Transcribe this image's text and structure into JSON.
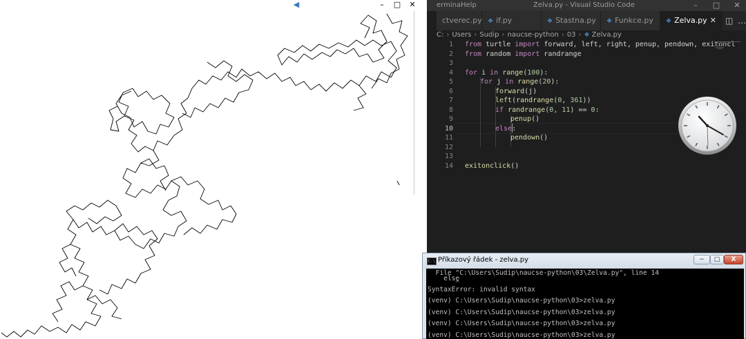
{
  "vscode": {
    "menu_visible": [
      "erminal",
      "Help"
    ],
    "title": "Zelva.py - Visual Studio Code",
    "tabs": [
      {
        "label": "ctverec.py",
        "active": false
      },
      {
        "label": "if.py",
        "active": false
      },
      {
        "label": "Stastna.py",
        "active": false
      },
      {
        "label": "Funkce.py",
        "active": false
      },
      {
        "label": "Zelva.py",
        "active": true
      }
    ],
    "breadcrumb": [
      "C:",
      "Users",
      "Sudip",
      "naucse-python",
      "03",
      "Zelva.py"
    ],
    "line_numbers": [
      "1",
      "2",
      "3",
      "4",
      "5",
      "6",
      "7",
      "8",
      "9",
      "10",
      "11",
      "12",
      "13",
      "14"
    ],
    "current_line": "10",
    "code": {
      "l1_kw1": "from",
      "l1_mod": " turtle ",
      "l1_kw2": "import",
      "l1_rest": " forward, left, right, penup, pendown, exitoncl",
      "l2_kw1": "from",
      "l2_mod": " random ",
      "l2_kw2": "import",
      "l2_rest": " randrange",
      "l4_kw1": "for",
      "l4_mid": " i ",
      "l4_kw2": "in",
      "l4_fn": " range",
      "l4_a": "(",
      "l4_num": "100",
      "l4_b": "):",
      "l5_kw1": "for",
      "l5_mid": " j ",
      "l5_kw2": "in",
      "l5_fn": " range",
      "l5_a": "(",
      "l5_num": "20",
      "l5_b": "):",
      "l6_fn": "forward",
      "l6_rest": "(j)",
      "l7_fn": "left",
      "l7_a": "(",
      "l7_fn2": "randrange",
      "l7_b": "(",
      "l7_n1": "0",
      "l7_c": ", ",
      "l7_n2": "361",
      "l7_d": "))",
      "l8_kw": "if",
      "l8_fn": " randrange",
      "l8_a": "(",
      "l8_n1": "0",
      "l8_b": ", ",
      "l8_n2": "11",
      "l8_c": ") == ",
      "l8_n3": "0",
      "l8_d": ":",
      "l9_fn": "penup",
      "l9_rest": "()",
      "l10_kw": "else",
      "l10_rest": ":",
      "l11_fn": "pendown",
      "l11_rest": "()",
      "l14_fn": "exitonclick",
      "l14_rest": "()"
    }
  },
  "cmd": {
    "title": "Příkazový řádek - zelva.py",
    "min": "−",
    "max": "□",
    "close": "X",
    "lines": [
      "  File \"C:\\Users\\Sudip\\naucse-python\\03\\Zelva.py\", line 14",
      "    else",
      "       ^",
      "SyntaxError: invalid syntax",
      "",
      "(venv) C:\\Users\\Sudip\\naucse-python\\03>zelva.py",
      "",
      "(venv) C:\\Users\\Sudip\\naucse-python\\03>zelva.py",
      "",
      "(venv) C:\\Users\\Sudip\\naucse-python\\03>zelva.py",
      "",
      "(venv) C:\\Users\\Sudip\\naucse-python\\03>zelva.py"
    ]
  },
  "turtle_window": {
    "minimize": "–",
    "maximize": "□",
    "close": "✕"
  }
}
